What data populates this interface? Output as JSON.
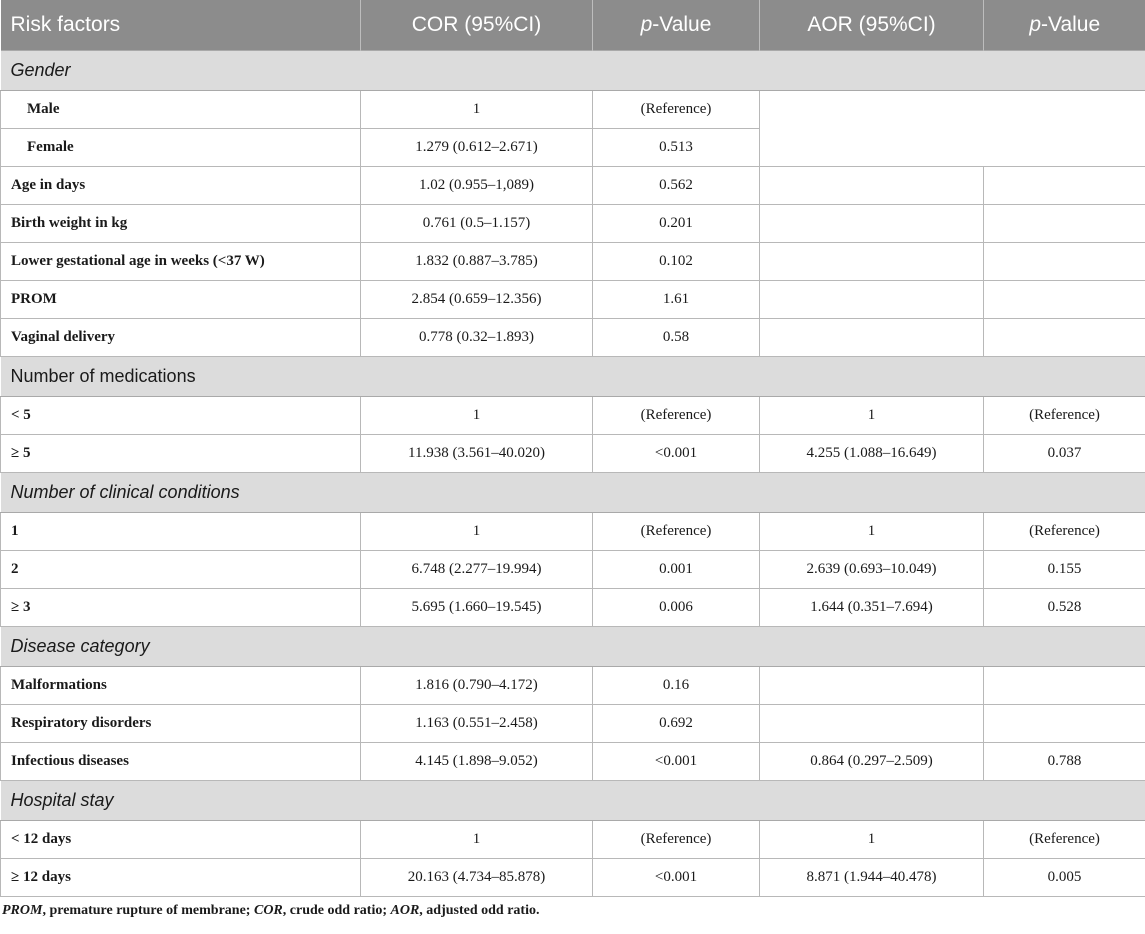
{
  "header": {
    "risk_factors": "Risk factors",
    "cor": "COR (95%CI)",
    "p_prefix": "p",
    "p_suffix": "-Value",
    "aor": "AOR (95%CI)"
  },
  "sections": {
    "gender": "Gender",
    "medications": "Number of medications",
    "clinical": "Number of clinical conditions",
    "disease": "Disease category",
    "hospital": "Hospital stay"
  },
  "rows": {
    "male": {
      "label": "Male",
      "cor": "1",
      "p": "(Reference)"
    },
    "female": {
      "label": "Female",
      "cor": "1.279 (0.612–2.671)",
      "p": "0.513"
    },
    "age": {
      "label": "Age in days",
      "cor": "1.02 (0.955–1,089)",
      "p": "0.562",
      "aor": "",
      "p2": ""
    },
    "weight": {
      "label": "Birth weight in kg",
      "cor": "0.761 (0.5–1.157)",
      "p": "0.201",
      "aor": "",
      "p2": ""
    },
    "gest": {
      "label": "Lower gestational age in weeks (<37 W)",
      "cor": "1.832 (0.887–3.785)",
      "p": "0.102",
      "aor": "",
      "p2": ""
    },
    "prom": {
      "label": "PROM",
      "cor": "2.854 (0.659–12.356)",
      "p": "1.61",
      "aor": "",
      "p2": ""
    },
    "vaginal": {
      "label": "Vaginal delivery",
      "cor": "0.778 (0.32–1.893)",
      "p": "0.58",
      "aor": "",
      "p2": ""
    },
    "med_lt5": {
      "label": "< 5",
      "cor": "1",
      "p": "(Reference)",
      "aor": "1",
      "p2": "(Reference)"
    },
    "med_ge5": {
      "label": "≥ 5",
      "cor": "11.938 (3.561–40.020)",
      "p": "<0.001",
      "aor": "4.255 (1.088–16.649)",
      "p2": "0.037"
    },
    "cc1": {
      "label": "1",
      "cor": "1",
      "p": "(Reference)",
      "aor": "1",
      "p2": "(Reference)"
    },
    "cc2": {
      "label": "2",
      "cor": "6.748 (2.277–19.994)",
      "p": "0.001",
      "aor": "2.639 (0.693–10.049)",
      "p2": "0.155"
    },
    "cc3": {
      "label": "≥ 3",
      "cor": "5.695 (1.660–19.545)",
      "p": "0.006",
      "aor": "1.644 (0.351–7.694)",
      "p2": "0.528"
    },
    "malf": {
      "label": "Malformations",
      "cor": "1.816 (0.790–4.172)",
      "p": "0.16",
      "aor": "",
      "p2": ""
    },
    "resp": {
      "label": "Respiratory disorders",
      "cor": "1.163 (0.551–2.458)",
      "p": "0.692",
      "aor": "",
      "p2": ""
    },
    "infect": {
      "label": "Infectious diseases",
      "cor": "4.145 (1.898–9.052)",
      "p": "<0.001",
      "aor": "0.864 (0.297–2.509)",
      "p2": "0.788"
    },
    "hs_lt12": {
      "label": "< 12 days",
      "cor": "1",
      "p": "(Reference)",
      "aor": "1",
      "p2": "(Reference)"
    },
    "hs_ge12": {
      "label": "≥ 12 days",
      "cor": "20.163 (4.734–85.878)",
      "p": "<0.001",
      "aor": "8.871 (1.944–40.478)",
      "p2": "0.005"
    }
  },
  "footnote": {
    "prom_abbr": "PROM",
    "prom_def": ", premature rupture of membrane; ",
    "cor_abbr": "COR",
    "cor_def": ", crude odd ratio; ",
    "aor_abbr": "AOR",
    "aor_def": ", adjusted odd ratio."
  }
}
